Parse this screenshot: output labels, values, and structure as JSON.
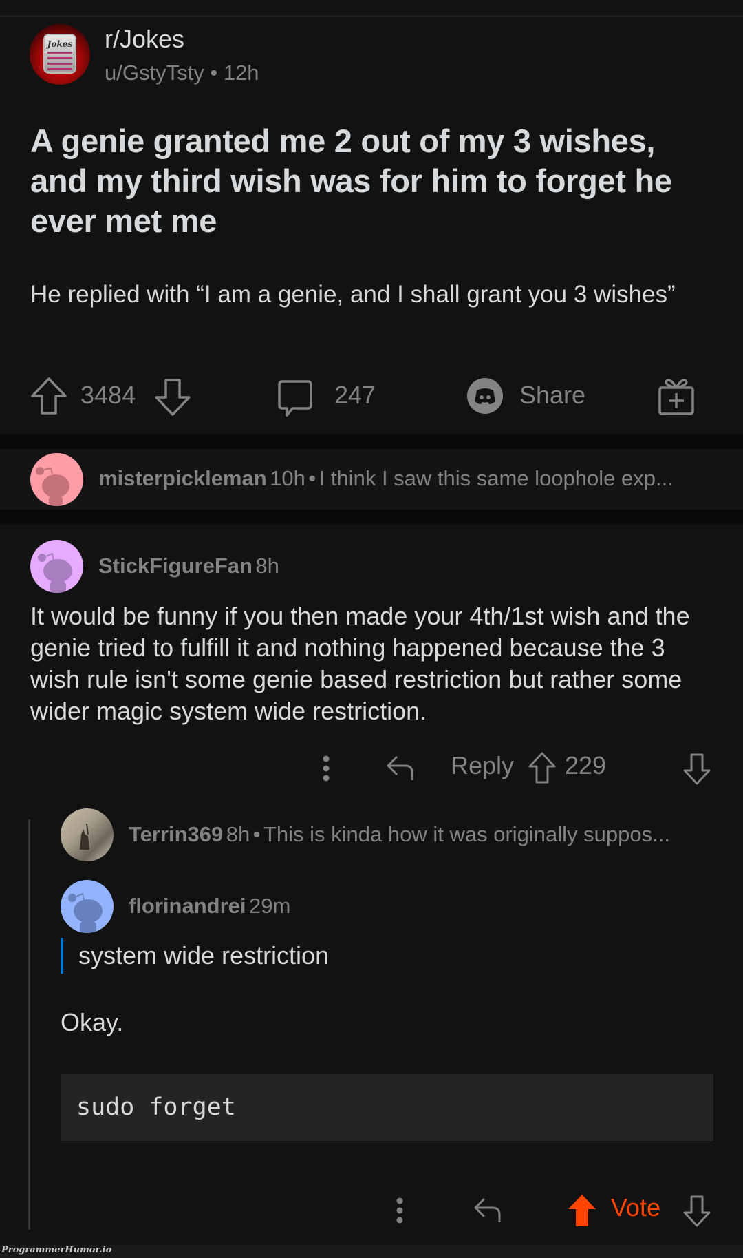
{
  "post": {
    "subreddit": "r/Jokes",
    "subreddit_icon_label": "Jokes",
    "author": "u/GstyTsty",
    "separator": "•",
    "age": "12h",
    "title": "A genie granted me 2 out of my 3 wishes, and my third wish was for him to forget he ever met me",
    "body": "He replied with “I am a genie, and I shall grant you 3 wishes”",
    "score": "3484",
    "comment_count": "247",
    "share_label": "Share"
  },
  "comments": {
    "collapsed_1": {
      "username": "misterpickleman",
      "age": "10h",
      "separator": "•",
      "preview": "I think I saw this same loophole exp..."
    },
    "main": {
      "username": "StickFigureFan",
      "age": "8h",
      "text": "It would be funny if you then made your 4th/1st wish and the genie tried to fulfill it and nothing happened because the 3 wish rule isn't some genie based restriction but rather some wider magic system wide restriction.",
      "reply_label": "Reply",
      "score": "229"
    },
    "collapsed_2": {
      "username": "Terrin369",
      "age": "8h",
      "separator": "•",
      "preview": "This is kinda how it was originally suppos..."
    },
    "reply": {
      "username": "florinandrei",
      "age": "29m",
      "quote": "system wide restriction",
      "text": "Okay.",
      "code": "sudo forget",
      "vote_label": "Vote"
    }
  },
  "colors": {
    "background": "#121212",
    "text": "#d7dadc",
    "muted": "#818384",
    "upvote_active": "#ff4500",
    "quote_bar": "#0079d3",
    "avatar_pink": "#ff9da6",
    "avatar_purple": "#e4abff",
    "avatar_blue": "#94b3ff"
  },
  "watermark": "ProgrammerHumor.io"
}
